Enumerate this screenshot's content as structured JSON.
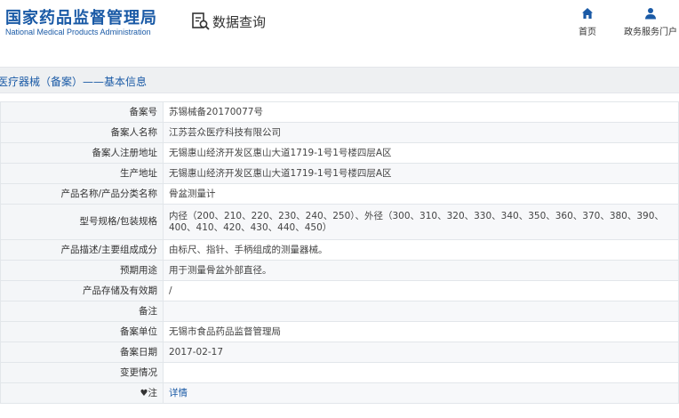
{
  "header": {
    "logo_cn": "国家药品监督管理局",
    "logo_en": "National Medical Products Administration",
    "query_title": "数据查询",
    "query_icon": "search-document-icon",
    "nav": [
      {
        "label": "首页",
        "icon": "home-icon"
      },
      {
        "label": "政务服务门户",
        "icon": "user-icon"
      }
    ]
  },
  "page_title": "医疗器械（备案）——基本信息",
  "colors": {
    "brand": "#1a5aa6",
    "title_bar": "#eef0f2",
    "label_bg": "#f4f6f8",
    "border": "#e2e6ea"
  },
  "rows": [
    {
      "label": "备案号",
      "value": "苏锡械备20170077号"
    },
    {
      "label": "备案人名称",
      "value": "江苏芸众医疗科技有限公司"
    },
    {
      "label": "备案人注册地址",
      "value": "无锡惠山经济开发区惠山大道1719-1号1号楼四层A区"
    },
    {
      "label": "生产地址",
      "value": "无锡惠山经济开发区惠山大道1719-1号1号楼四层A区"
    },
    {
      "label": "产品名称/产品分类名称",
      "value": "骨盆测量计"
    },
    {
      "label": "型号规格/包装规格",
      "value": "内径（200、210、220、230、240、250）、外径（300、310、320、330、340、350、360、370、380、390、400、410、420、430、440、450）"
    },
    {
      "label": "产品描述/主要组成成分",
      "value": "由标尺、指针、手柄组成的测量器械。"
    },
    {
      "label": "预期用途",
      "value": "用于测量骨盆外部直径。"
    },
    {
      "label": "产品存储及有效期",
      "value": "/"
    },
    {
      "label": "备注",
      "value": ""
    },
    {
      "label": "备案单位",
      "value": "无锡市食品药品监督管理局"
    },
    {
      "label": "备案日期",
      "value": "2017-02-17"
    },
    {
      "label": "变更情况",
      "value": ""
    },
    {
      "label": "注",
      "value": "详情",
      "pin_glyph": "♥"
    }
  ]
}
